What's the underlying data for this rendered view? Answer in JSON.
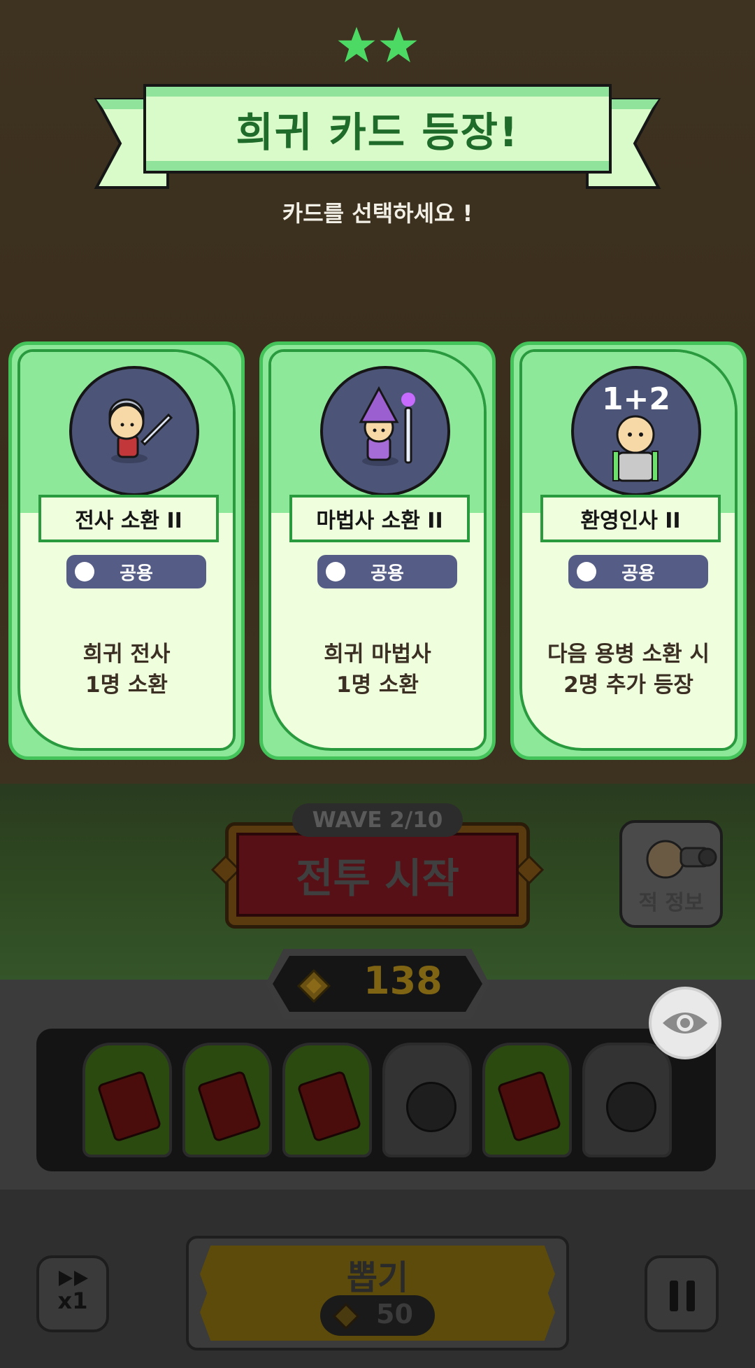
{
  "header": {
    "stars": 2,
    "title": "희귀 카드 등장!",
    "subtitle": "카드를 선택하세요 !"
  },
  "cards": [
    {
      "name": "전사 소환 II",
      "tag": "공용",
      "desc_line1": "희귀 전사",
      "desc_line2": "1명 소환",
      "icon": "warrior-icon"
    },
    {
      "name": "마법사 소환 II",
      "tag": "공용",
      "desc_line1": "희귀 마법사",
      "desc_line2": "1명 소환",
      "icon": "wizard-icon"
    },
    {
      "name": "환영인사 II",
      "tag": "공용",
      "badge": "1+2",
      "desc_line1": "다음 용병 소환 시",
      "desc_line2": "2명 추가 등장",
      "icon": "greeter-icon"
    }
  ],
  "battle": {
    "wave": "WAVE 2/10",
    "start_label": "전투 시작",
    "enemy_info_label": "적 정보"
  },
  "coins": {
    "value": "138"
  },
  "slots": [
    "card",
    "card",
    "card",
    "empty",
    "card",
    "empty"
  ],
  "controls": {
    "speed_label": "x1",
    "draw_label": "뽑기",
    "draw_cost": "50"
  },
  "colors": {
    "card_green": "#8ee89a",
    "card_border": "#43c35a",
    "title_text": "#1f6b2a",
    "star": "#4cd964",
    "tag_bg": "#555d86"
  }
}
